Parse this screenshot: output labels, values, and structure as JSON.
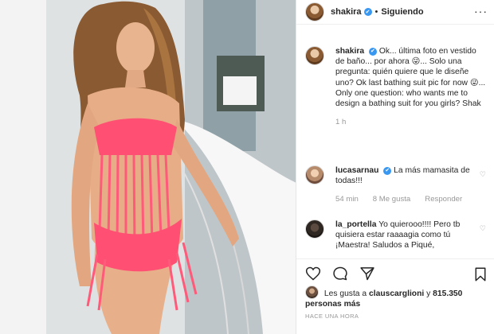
{
  "header": {
    "username": "shakira",
    "verified_mark": "✔",
    "separator": "•",
    "follow_status": "Siguiendo",
    "more_label": "···"
  },
  "caption": {
    "username": "shakira",
    "text": "Ok... última foto en vestido de baño... por ahora 😜... Solo una pregunta: quién quiere que le diseñe uno? Ok last bathing suit pic for now 😜... Only one question: who wants me to design a bathing suit for you girls? Shak",
    "time": "1 h"
  },
  "comments": [
    {
      "username": "lucasarnau",
      "verified": true,
      "text": "La más mamasita de todas!!!",
      "time": "54 min",
      "likes": "8 Me gusta",
      "reply_label": "Responder"
    },
    {
      "username": "la_portella",
      "verified": false,
      "text": "Yo quierooo!!!! Pero tb quisiera estar raaaagia como tú ¡Maestra! Saludos a Piqué,"
    }
  ],
  "likes": {
    "prefix": "Les gusta a",
    "user": "clauscarglioni",
    "conjunction": "y",
    "count": "815.350 personas más"
  },
  "timestamp": "HACE UNA HORA",
  "icons": {
    "like": "heart-icon",
    "comment": "comment-icon",
    "share": "share-icon",
    "save": "bookmark-icon",
    "more": "more-icon"
  },
  "colors": {
    "verified": "#3897f0",
    "swimsuit": "#ff4f72",
    "muted_text": "#999999"
  }
}
